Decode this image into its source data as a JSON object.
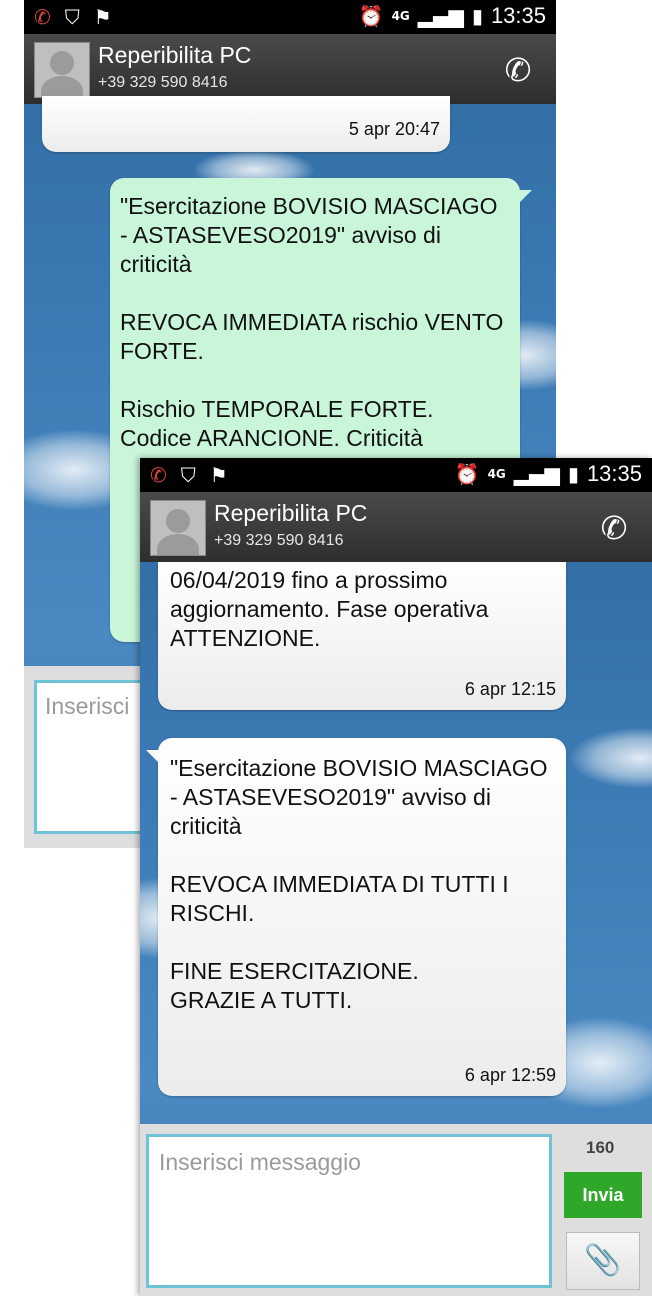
{
  "status_bar": {
    "time": "13:35",
    "network": "4G",
    "icons": [
      "missed-call-icon",
      "shield-icon",
      "flag-icon",
      "alarm-icon",
      "network-4g-icon",
      "signal-icon",
      "battery-icon"
    ]
  },
  "header": {
    "contact_name": "Reperibilita PC",
    "contact_number": "+39 329 590 8416",
    "call_icon": "phone-icon"
  },
  "back_screen": {
    "prev_time": "5 apr 20:47",
    "sent_message": "\"Esercitazione BOVISIO MASCIAGO - ASTASEVESO2019\" avviso di criticità\n\nREVOCA IMMEDIATA rischio VENTO FORTE.\n\nRischio TEMPORALE FORTE. Codice ARANCIONE. Criticità",
    "peek_lines": [
      "M",
      "06",
      "ag",
      "AT"
    ],
    "input_placeholder_partial": "Inserisci"
  },
  "front_screen": {
    "messages": [
      {
        "text": "06/04/2019 fino a prossimo aggiornamento. Fase operativa ATTENZIONE.",
        "time": "6 apr 12:15"
      },
      {
        "text": "\"Esercitazione BOVISIO MASCIAGO - ASTASEVESO2019\" avviso di criticità\n\nREVOCA IMMEDIATA DI TUTTI I RISCHI.\n\nFINE ESERCITAZIONE.\nGRAZIE A TUTTI.",
        "time": "6 apr 12:59"
      }
    ],
    "composer": {
      "placeholder": "Inserisci messaggio",
      "char_count": "160",
      "send_label": "Invia",
      "attach_icon": "paperclip-icon"
    }
  },
  "colors": {
    "sent_bubble": "#c9f5d9",
    "received_bubble": "#ffffff",
    "send_button": "#2fa82a",
    "input_border": "#6fc3d9",
    "background_sky": "#3c7bb5"
  }
}
